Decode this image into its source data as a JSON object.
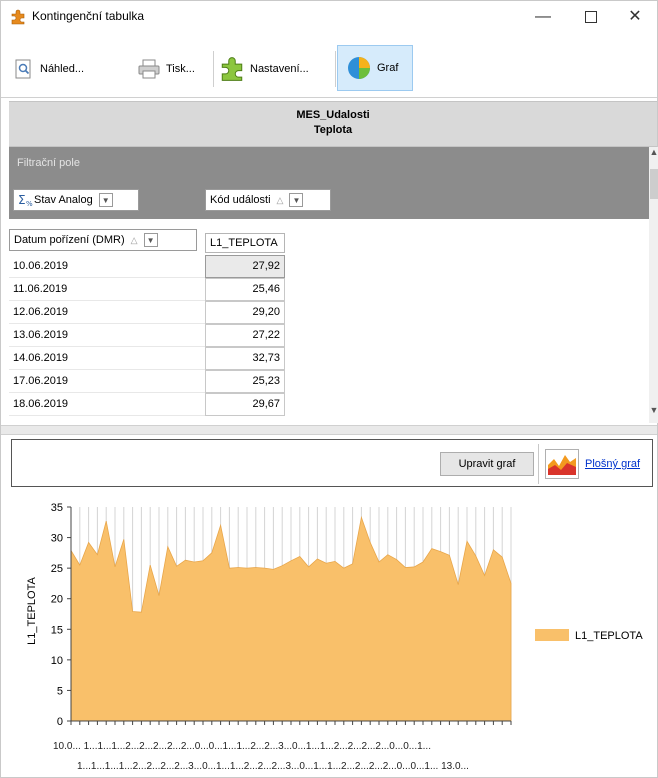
{
  "window": {
    "title": "Kontingenční tabulka",
    "minimize": "—",
    "close": "✕"
  },
  "toolbar": {
    "preview_label": "Náhled...",
    "print_label": "Tisk...",
    "settings_label": "Nastavení...",
    "graph_label": "Graf"
  },
  "header": {
    "line1": "MES_Udalosti",
    "line2": "Teplota"
  },
  "pivot": {
    "filter_area_label": "Filtrační pole",
    "column_fields": [
      "Stav Analog",
      "Kód události"
    ],
    "row_field": "Datum pořízení (DMR)",
    "value_header": "L1_TEPLOTA",
    "rows": [
      {
        "date": "10.06.2019",
        "value": "27,92"
      },
      {
        "date": "11.06.2019",
        "value": "25,46"
      },
      {
        "date": "12.06.2019",
        "value": "29,20"
      },
      {
        "date": "13.06.2019",
        "value": "27,22"
      },
      {
        "date": "14.06.2019",
        "value": "32,73"
      },
      {
        "date": "17.06.2019",
        "value": "25,23"
      },
      {
        "date": "18.06.2019",
        "value": "29,67"
      }
    ]
  },
  "chart_toolbar": {
    "edit_label": "Upravit graf",
    "chart_type_link": "Plošný graf"
  },
  "chart_data": {
    "type": "area",
    "ylabel": "L1_TEPLOTA",
    "ylim": [
      0,
      35
    ],
    "yticks": [
      0,
      5,
      10,
      15,
      20,
      25,
      30,
      35
    ],
    "grid": "vertical",
    "legend_position": "right",
    "color": "#f9c06a",
    "series": [
      {
        "name": "L1_TEPLOTA",
        "values": [
          27.9,
          25.5,
          29.2,
          27.2,
          32.7,
          25.2,
          29.7,
          17.9,
          17.8,
          25.5,
          20.5,
          28.5,
          25.3,
          26.3,
          26.0,
          26.2,
          27.5,
          32.0,
          25.0,
          25.1,
          25.0,
          25.1,
          25.0,
          24.8,
          25.4,
          26.2,
          26.9,
          25.2,
          26.5,
          25.8,
          26.1,
          25.0,
          25.7,
          33.3,
          29.2,
          26.0,
          27.2,
          26.4,
          25.1,
          25.2,
          26.0,
          28.2,
          27.7,
          27.1,
          22.3,
          29.4,
          27.0,
          23.8,
          28.0,
          26.8,
          22.5
        ]
      }
    ],
    "x_tick_row1": "10.0... 1...1...1...2...2...2...2...2...0...0...1...1...2...2...3...0...1...1...2...2...2...2...0...0...1...",
    "x_tick_row2": "1...1...1...1...2...2...2...2...3...0...1...1...2...2...2...3...0...1...1...2...2...2...2...0...0...1... 13.0..."
  }
}
